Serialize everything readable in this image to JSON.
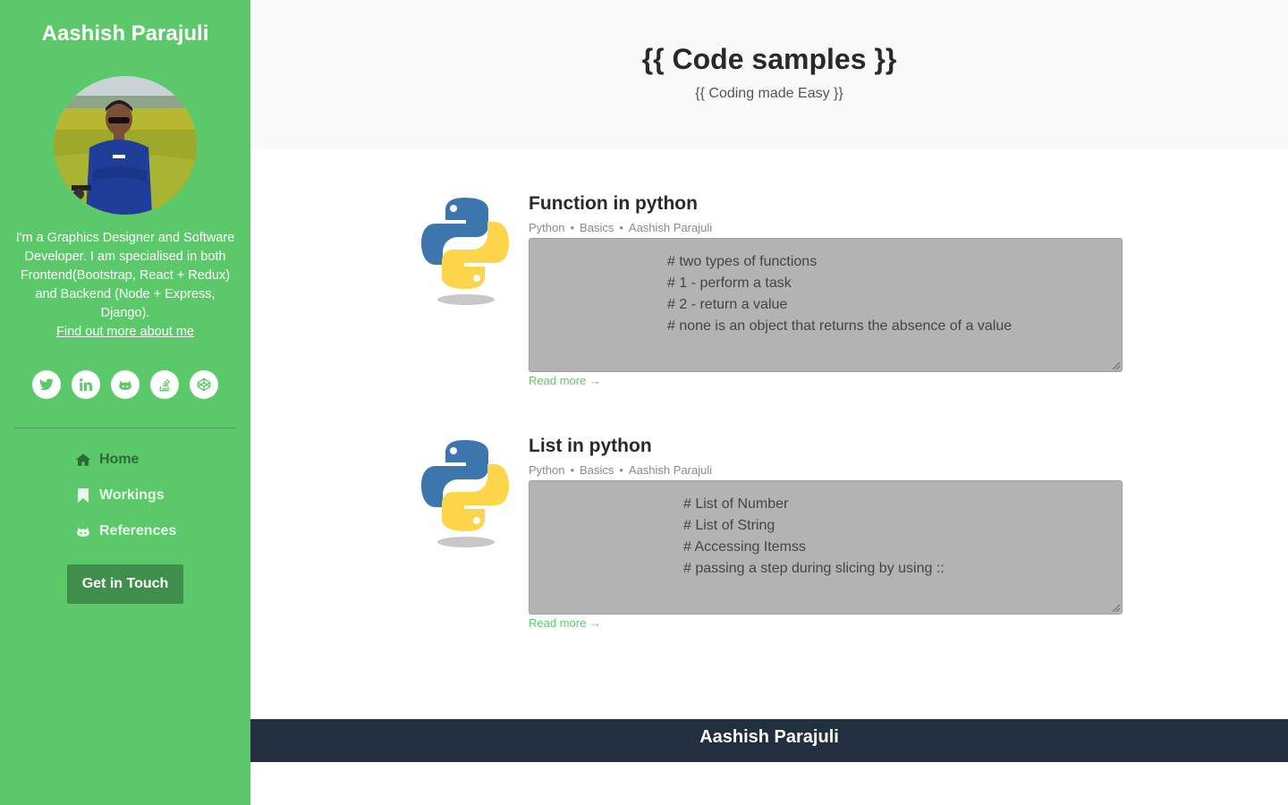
{
  "sidebar": {
    "name": "Aashish Parajuli",
    "bio": "I'm a Graphics Designer and Software Developer. I am specialised in both Frontend(Bootstrap, React + Redux) and Backend (Node + Express, Django).",
    "about_link": "Find out more about me",
    "socials": [
      {
        "icon": "twitter-icon"
      },
      {
        "icon": "linkedin-icon"
      },
      {
        "icon": "github-icon"
      },
      {
        "icon": "stack-overflow-icon"
      },
      {
        "icon": "codepen-icon"
      }
    ],
    "nav": [
      {
        "label": "Home",
        "icon": "home-icon"
      },
      {
        "label": "Workings",
        "icon": "bookmark-icon"
      },
      {
        "label": "References",
        "icon": "github-icon"
      }
    ],
    "cta_label": "Get in Touch",
    "colors": {
      "background": "#5bc96a",
      "cta": "#3f8e4b",
      "active_nav": "#2d6a35"
    }
  },
  "header": {
    "title": "{{ Code samples }}",
    "subtitle": "{{ Coding made Easy }}"
  },
  "posts": [
    {
      "title": "Function in python",
      "meta": [
        "Python",
        "Basics",
        "Aashish Parajuli"
      ],
      "code_lines": [
        "# two types of functions",
        "# 1 - perform a task",
        "# 2 - return a value",
        "# none is an object that returns the absence of a value"
      ],
      "read_more": "Read more →"
    },
    {
      "title": "List in python",
      "meta": [
        "Python",
        "Basics",
        "Aashish Parajuli"
      ],
      "code_lines": [
        "# List of Number",
        "# List of String",
        "# Accessing Itemss",
        "# passing a step during slicing by using ::"
      ],
      "read_more": "Read more →"
    }
  ],
  "footer": {
    "text": "Aashish Parajuli",
    "background": "#212f3f"
  }
}
